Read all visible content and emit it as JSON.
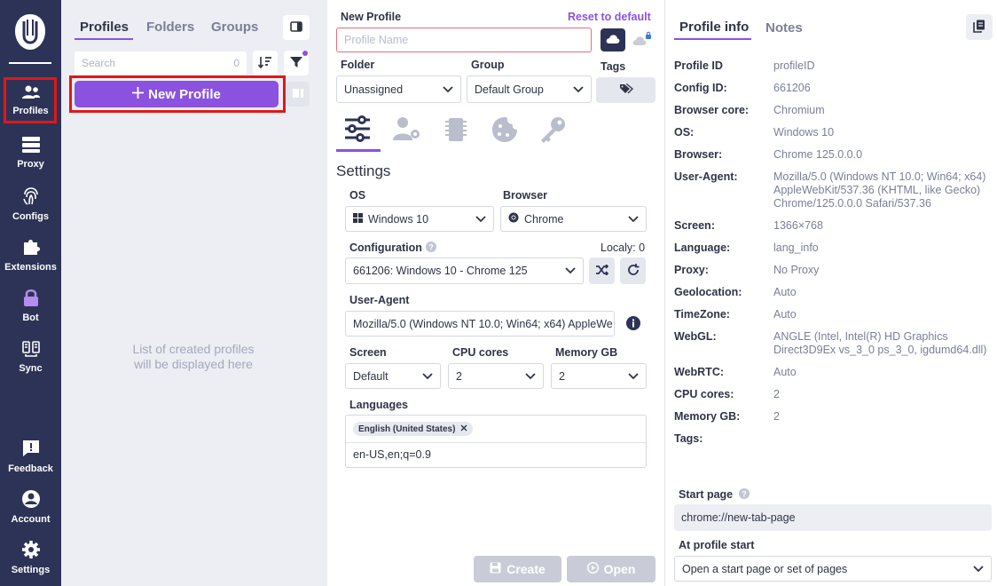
{
  "nav": {
    "items": [
      {
        "label": "Profiles",
        "icon": "profiles-icon"
      },
      {
        "label": "Proxy",
        "icon": "proxy-icon"
      },
      {
        "label": "Configs",
        "icon": "fingerprint-icon"
      },
      {
        "label": "Extensions",
        "icon": "puzzle-icon"
      },
      {
        "label": "Bot",
        "icon": "lock-icon"
      },
      {
        "label": "Sync",
        "icon": "sync-icon"
      },
      {
        "label": "Feedback",
        "icon": "feedback-icon"
      },
      {
        "label": "Account",
        "icon": "account-icon"
      },
      {
        "label": "Settings",
        "icon": "gear-icon"
      }
    ],
    "colors": {
      "background": "#2d3356",
      "accent": "#8b52e0",
      "highlight": "#e01818"
    }
  },
  "profiles_panel": {
    "tabs": [
      "Profiles",
      "Folders",
      "Groups"
    ],
    "search_placeholder": "Search",
    "search_count": "0",
    "new_profile_label": "New Profile",
    "empty_text_line1": "List of created profiles",
    "empty_text_line2": "will be displayed here"
  },
  "form": {
    "title": "New Profile",
    "reset_label": "Reset to default",
    "name_placeholder": "Profile Name",
    "folder_label": "Folder",
    "folder_value": "Unassigned",
    "group_label": "Group",
    "group_value": "Default Group",
    "tags_label": "Tags",
    "settings_title": "Settings",
    "os_label": "OS",
    "os_value": "Windows 10",
    "browser_label": "Browser",
    "browser_value": "Chrome",
    "config_label": "Configuration",
    "localy_label": "Localy: 0",
    "config_value": "661206: Windows 10 - Chrome 125",
    "ua_label": "User-Agent",
    "ua_value": "Mozilla/5.0 (Windows NT 10.0; Win64; x64) AppleWe",
    "screen_label": "Screen",
    "screen_value": "Default",
    "cpu_label": "CPU cores",
    "cpu_value": "2",
    "memory_label": "Memory GB",
    "memory_value": "2",
    "languages_label": "Languages",
    "language_chip": "English (United States)",
    "languages_value": "en-US,en;q=0.9",
    "create_label": "Create",
    "open_label": "Open"
  },
  "info": {
    "tabs": [
      "Profile info",
      "Notes"
    ],
    "rows": [
      {
        "key": "Profile ID",
        "value": "profileID"
      },
      {
        "key": "Config ID:",
        "value": "661206"
      },
      {
        "key": "Browser core:",
        "value": "Chromium"
      },
      {
        "key": "OS:",
        "value": "Windows 10"
      },
      {
        "key": "Browser:",
        "value": "Chrome 125.0.0.0"
      },
      {
        "key": "User-Agent:",
        "value": "Mozilla/5.0 (Windows NT 10.0; Win64; x64) AppleWebKit/537.36 (KHTML, like Gecko) Chrome/125.0.0.0 Safari/537.36"
      },
      {
        "key": "Screen:",
        "value": "1366×768"
      },
      {
        "key": "Language:",
        "value": "lang_info"
      },
      {
        "key": "Proxy:",
        "value": "No Proxy"
      },
      {
        "key": "Geolocation:",
        "value": "Auto"
      },
      {
        "key": "TimeZone:",
        "value": "Auto"
      },
      {
        "key": "WebGL:",
        "value": "ANGLE (Intel, Intel(R) HD Graphics Direct3D9Ex vs_3_0 ps_3_0, igdumd64.dll)"
      },
      {
        "key": "WebRTC:",
        "value": "Auto"
      },
      {
        "key": "CPU cores:",
        "value": "2"
      },
      {
        "key": "Memory GB:",
        "value": "2"
      },
      {
        "key": "Tags:",
        "value": ""
      }
    ],
    "start_page_label": "Start page",
    "start_page_value": "chrome://new-tab-page",
    "at_start_label": "At profile start",
    "at_start_value": "Open a start page or set of pages"
  }
}
